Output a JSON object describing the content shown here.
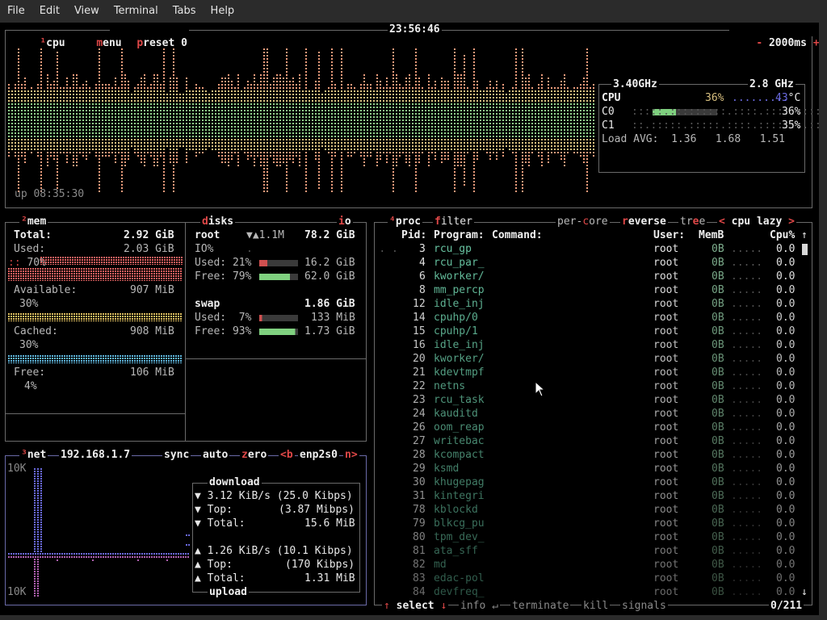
{
  "menu": [
    "File",
    "Edit",
    "View",
    "Terminal",
    "Tabs",
    "Help"
  ],
  "cpu_box": {
    "num": "¹",
    "title": "cpu",
    "menu": "menu",
    "preset": "preset 0",
    "clock": "23:56:46",
    "minus": "-",
    "interval": "2000ms",
    "plus": "+",
    "uptime": "up 08:35:30",
    "freq": "3.40GHz",
    "freq2": "2.8 GHz",
    "cpu_label": "CPU",
    "cpu_pct": "36%",
    "cpu_temp": "43",
    "temp_unit": "°C",
    "c0_label": "C0",
    "c0_pct": "36%",
    "c1_label": "C1",
    "c1_pct": "35%",
    "load_label": "Load AVG:",
    "load1": "1.36",
    "load5": "1.68",
    "load15": "1.51"
  },
  "mem_box": {
    "num": "²",
    "title": "mem",
    "total_label": "Total:",
    "total": "2.92 GiB",
    "used_label": "Used:",
    "used": "2.03 GiB",
    "used_pct": "70%",
    "avail_label": "Available:",
    "avail": "907 MiB",
    "avail_pct": "30%",
    "cached_label": "Cached:",
    "cached": "908 MiB",
    "cached_pct": "30%",
    "free_label": "Free:",
    "free": "106 MiB",
    "free_pct": "4%"
  },
  "disks_box": {
    "title_key": "d",
    "title": "isks",
    "io_key": "i",
    "io": "o",
    "root_label": "root",
    "root_io": "▼▲1.1M",
    "root_total": "78.2 GiB",
    "io_label": "IO%",
    "root_used_label": "Used: 21%",
    "root_used": "16.2 GiB",
    "root_used_fraction": 0.21,
    "root_free_label": "Free: 79%",
    "root_free": "62.0 GiB",
    "root_free_fraction": 0.79,
    "swap_label": "swap",
    "swap_total": "1.86 GiB",
    "swap_used_label": "Used:  7%",
    "swap_used": "133 MiB",
    "swap_used_fraction": 0.07,
    "swap_free_label": "Free: 93%",
    "swap_free": "1.73 GiB",
    "swap_free_fraction": 0.93
  },
  "net_box": {
    "num": "³",
    "title": "net",
    "ip": "192.168.1.7",
    "sync": "sync",
    "auto": "auto",
    "zero_key": "z",
    "zero": "ero",
    "iface_prev": "<b",
    "iface": "enp2s0",
    "iface_next": "n>",
    "scale_top": "10K",
    "scale_bottom": "10K",
    "download_title": "download",
    "dl_rate": "3.12 KiB/s",
    "dl_rate_bits": "(25.0 Kibps)",
    "dl_top_label": "Top:",
    "dl_top": "(3.87 Mibps)",
    "dl_total_label": "Total:",
    "dl_total": "15.6 MiB",
    "ul_rate": "1.26 KiB/s",
    "ul_rate_bits": "(10.1 Kibps)",
    "ul_top_label": "Top:",
    "ul_top": "(170 Kibps)",
    "ul_total_label": "Total:",
    "ul_total": "1.31 MiB",
    "upload_title": "upload",
    "arrow_down": "▼",
    "arrow_up": "▲"
  },
  "proc_box": {
    "num": "⁴",
    "title": "proc",
    "filter_key": "f",
    "filter": "ilter",
    "percore_key": "per-",
    "percore": "core",
    "reverse_key": "r",
    "reverse": "everse",
    "tree_a": "tr",
    "tree_key": "e",
    "tree_b": "e",
    "sort_prev": "<",
    "sort": "cpu lazy",
    "sort_next": ">",
    "col_pid": "Pid:",
    "col_program": "Program:",
    "col_command": "Command:",
    "col_user": "User:",
    "col_mem": "MemB",
    "col_cpu": "Cpu%",
    "scroll_up": "↑",
    "scroll_down": "↓",
    "footer_up": "↑",
    "footer_select": "select",
    "footer_down": "↓",
    "footer_info": "info",
    "footer_enter": "↵",
    "footer_terminate": "terminate",
    "footer_kill": "kill",
    "footer_signals": "signals",
    "count": "0/211",
    "rows": [
      {
        "pid": "3",
        "program": "rcu_gp",
        "user": "root",
        "mem": "0B",
        "cpu": "0.0"
      },
      {
        "pid": "4",
        "program": "rcu_par_",
        "user": "root",
        "mem": "0B",
        "cpu": "0.0"
      },
      {
        "pid": "6",
        "program": "kworker/",
        "user": "root",
        "mem": "0B",
        "cpu": "0.0"
      },
      {
        "pid": "8",
        "program": "mm_percp",
        "user": "root",
        "mem": "0B",
        "cpu": "0.0"
      },
      {
        "pid": "12",
        "program": "idle_inj",
        "user": "root",
        "mem": "0B",
        "cpu": "0.0"
      },
      {
        "pid": "14",
        "program": "cpuhp/0",
        "user": "root",
        "mem": "0B",
        "cpu": "0.0"
      },
      {
        "pid": "15",
        "program": "cpuhp/1",
        "user": "root",
        "mem": "0B",
        "cpu": "0.0"
      },
      {
        "pid": "16",
        "program": "idle_inj",
        "user": "root",
        "mem": "0B",
        "cpu": "0.0"
      },
      {
        "pid": "20",
        "program": "kworker/",
        "user": "root",
        "mem": "0B",
        "cpu": "0.0"
      },
      {
        "pid": "21",
        "program": "kdevtmpf",
        "user": "root",
        "mem": "0B",
        "cpu": "0.0"
      },
      {
        "pid": "22",
        "program": "netns",
        "user": "root",
        "mem": "0B",
        "cpu": "0.0"
      },
      {
        "pid": "23",
        "program": "rcu_task",
        "user": "root",
        "mem": "0B",
        "cpu": "0.0"
      },
      {
        "pid": "24",
        "program": "kauditd",
        "user": "root",
        "mem": "0B",
        "cpu": "0.0"
      },
      {
        "pid": "26",
        "program": "oom_reap",
        "user": "root",
        "mem": "0B",
        "cpu": "0.0"
      },
      {
        "pid": "27",
        "program": "writebac",
        "user": "root",
        "mem": "0B",
        "cpu": "0.0"
      },
      {
        "pid": "28",
        "program": "kcompact",
        "user": "root",
        "mem": "0B",
        "cpu": "0.0"
      },
      {
        "pid": "29",
        "program": "ksmd",
        "user": "root",
        "mem": "0B",
        "cpu": "0.0"
      },
      {
        "pid": "30",
        "program": "khugepag",
        "user": "root",
        "mem": "0B",
        "cpu": "0.0"
      },
      {
        "pid": "31",
        "program": "kintegri",
        "user": "root",
        "mem": "0B",
        "cpu": "0.0"
      },
      {
        "pid": "78",
        "program": "kblockd",
        "user": "root",
        "mem": "0B",
        "cpu": "0.0"
      },
      {
        "pid": "79",
        "program": "blkcg_pu",
        "user": "root",
        "mem": "0B",
        "cpu": "0.0"
      },
      {
        "pid": "80",
        "program": "tpm_dev_",
        "user": "root",
        "mem": "0B",
        "cpu": "0.0"
      },
      {
        "pid": "81",
        "program": "ata_sff",
        "user": "root",
        "mem": "0B",
        "cpu": "0.0"
      },
      {
        "pid": "82",
        "program": "md",
        "user": "root",
        "mem": "0B",
        "cpu": "0.0"
      },
      {
        "pid": "83",
        "program": "edac-pol",
        "user": "root",
        "mem": "0B",
        "cpu": "0.0"
      },
      {
        "pid": "84",
        "program": "devfreq_",
        "user": "root",
        "mem": "0B",
        "cpu": "0.0"
      }
    ]
  },
  "colors": {
    "graph_top": "#e89a7a",
    "graph_mid": "#d8c080",
    "graph_low": "#8fce8a",
    "mem_used": "#e06060",
    "mem_avail": "#e0c060",
    "mem_cached": "#60b8e0",
    "net_dl": "#6a6ae0",
    "net_ul": "#b060b0"
  }
}
